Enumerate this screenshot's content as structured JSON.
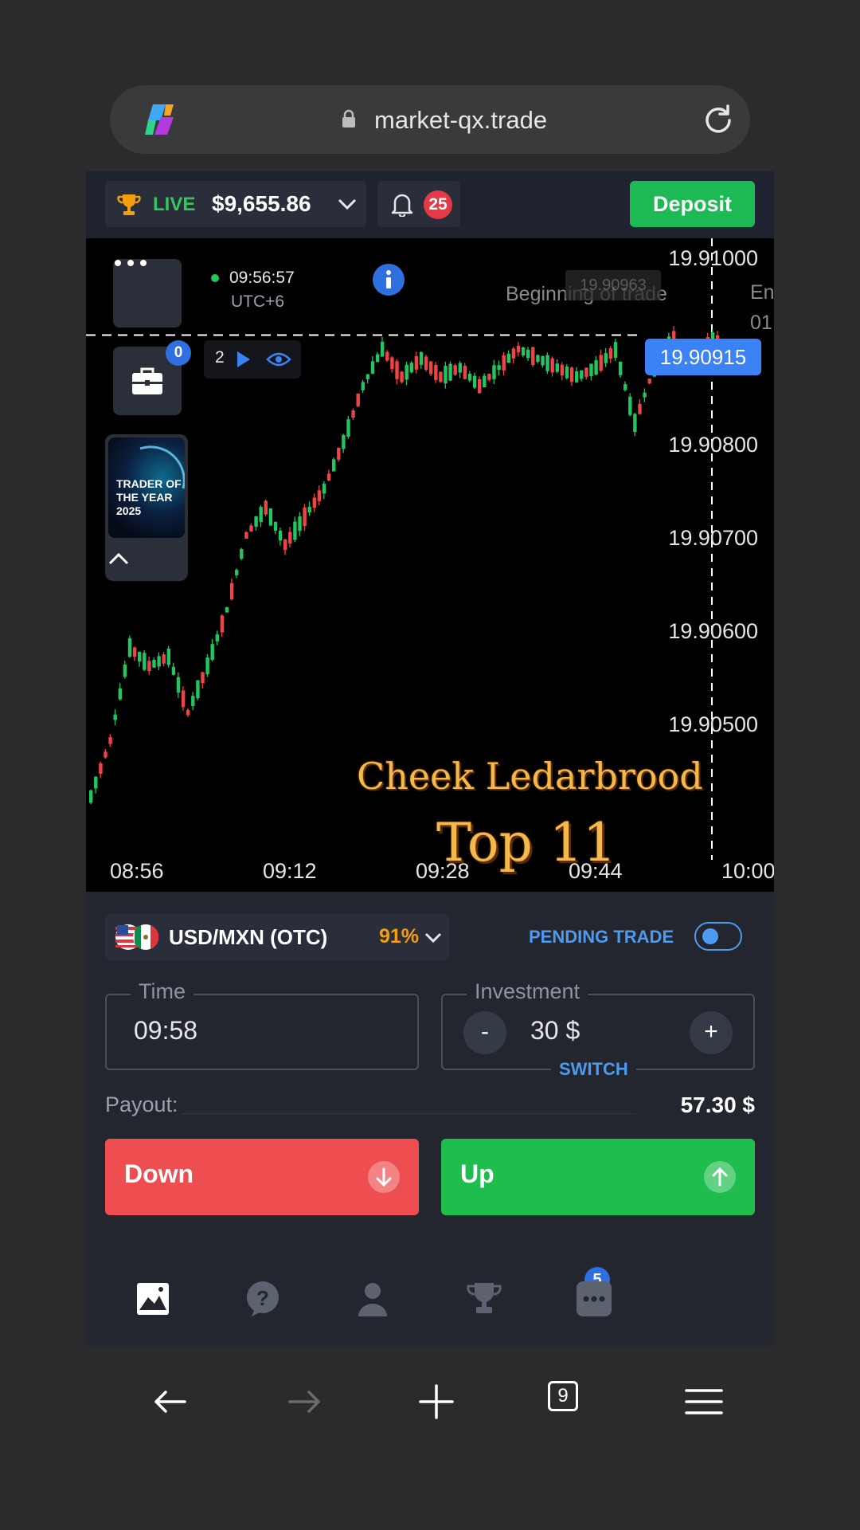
{
  "browser": {
    "url": "market-qx.trade",
    "tabs_count": "9"
  },
  "header": {
    "account_type": "LIVE",
    "balance": "$9,655.86",
    "notifications": "25",
    "deposit_label": "Deposit"
  },
  "chart": {
    "clock": "09:56:57",
    "timezone": "UTC+6",
    "current_price": "19.90915",
    "beginning_label": "Beginning of trade",
    "beginning_tag": "19.90963",
    "end_label": "En",
    "end_label_2": "01",
    "open_trades": "0",
    "eye_count": "2",
    "award_text": "TRADER OF THE YEAR 2025",
    "overlay_line1": "Cheek Ledarbrood",
    "overlay_line2": "Top 11",
    "price_levels": [
      "19.91000",
      "19.90800",
      "19.90700",
      "19.90600",
      "19.90500"
    ],
    "time_labels": [
      "08:56",
      "09:12",
      "09:28",
      "09:44",
      "10:00"
    ]
  },
  "trade": {
    "asset": "USD/MXN (OTC)",
    "payout_pct": "91%",
    "pending_label": "PENDING TRADE",
    "time_label": "Time",
    "time_value": "09:58",
    "investment_label": "Investment",
    "investment_value": "30 $",
    "minus": "-",
    "plus": "+",
    "switch_label": "SWITCH",
    "payout_label": "Payout:",
    "payout_value": "57.30 $",
    "down_label": "Down",
    "up_label": "Up"
  },
  "tabbar": {
    "trophy_badge": "5"
  },
  "colors": {
    "up": "#22c55e",
    "down": "#ef4444",
    "accent": "#3b82f6",
    "deposit": "#1db954"
  }
}
